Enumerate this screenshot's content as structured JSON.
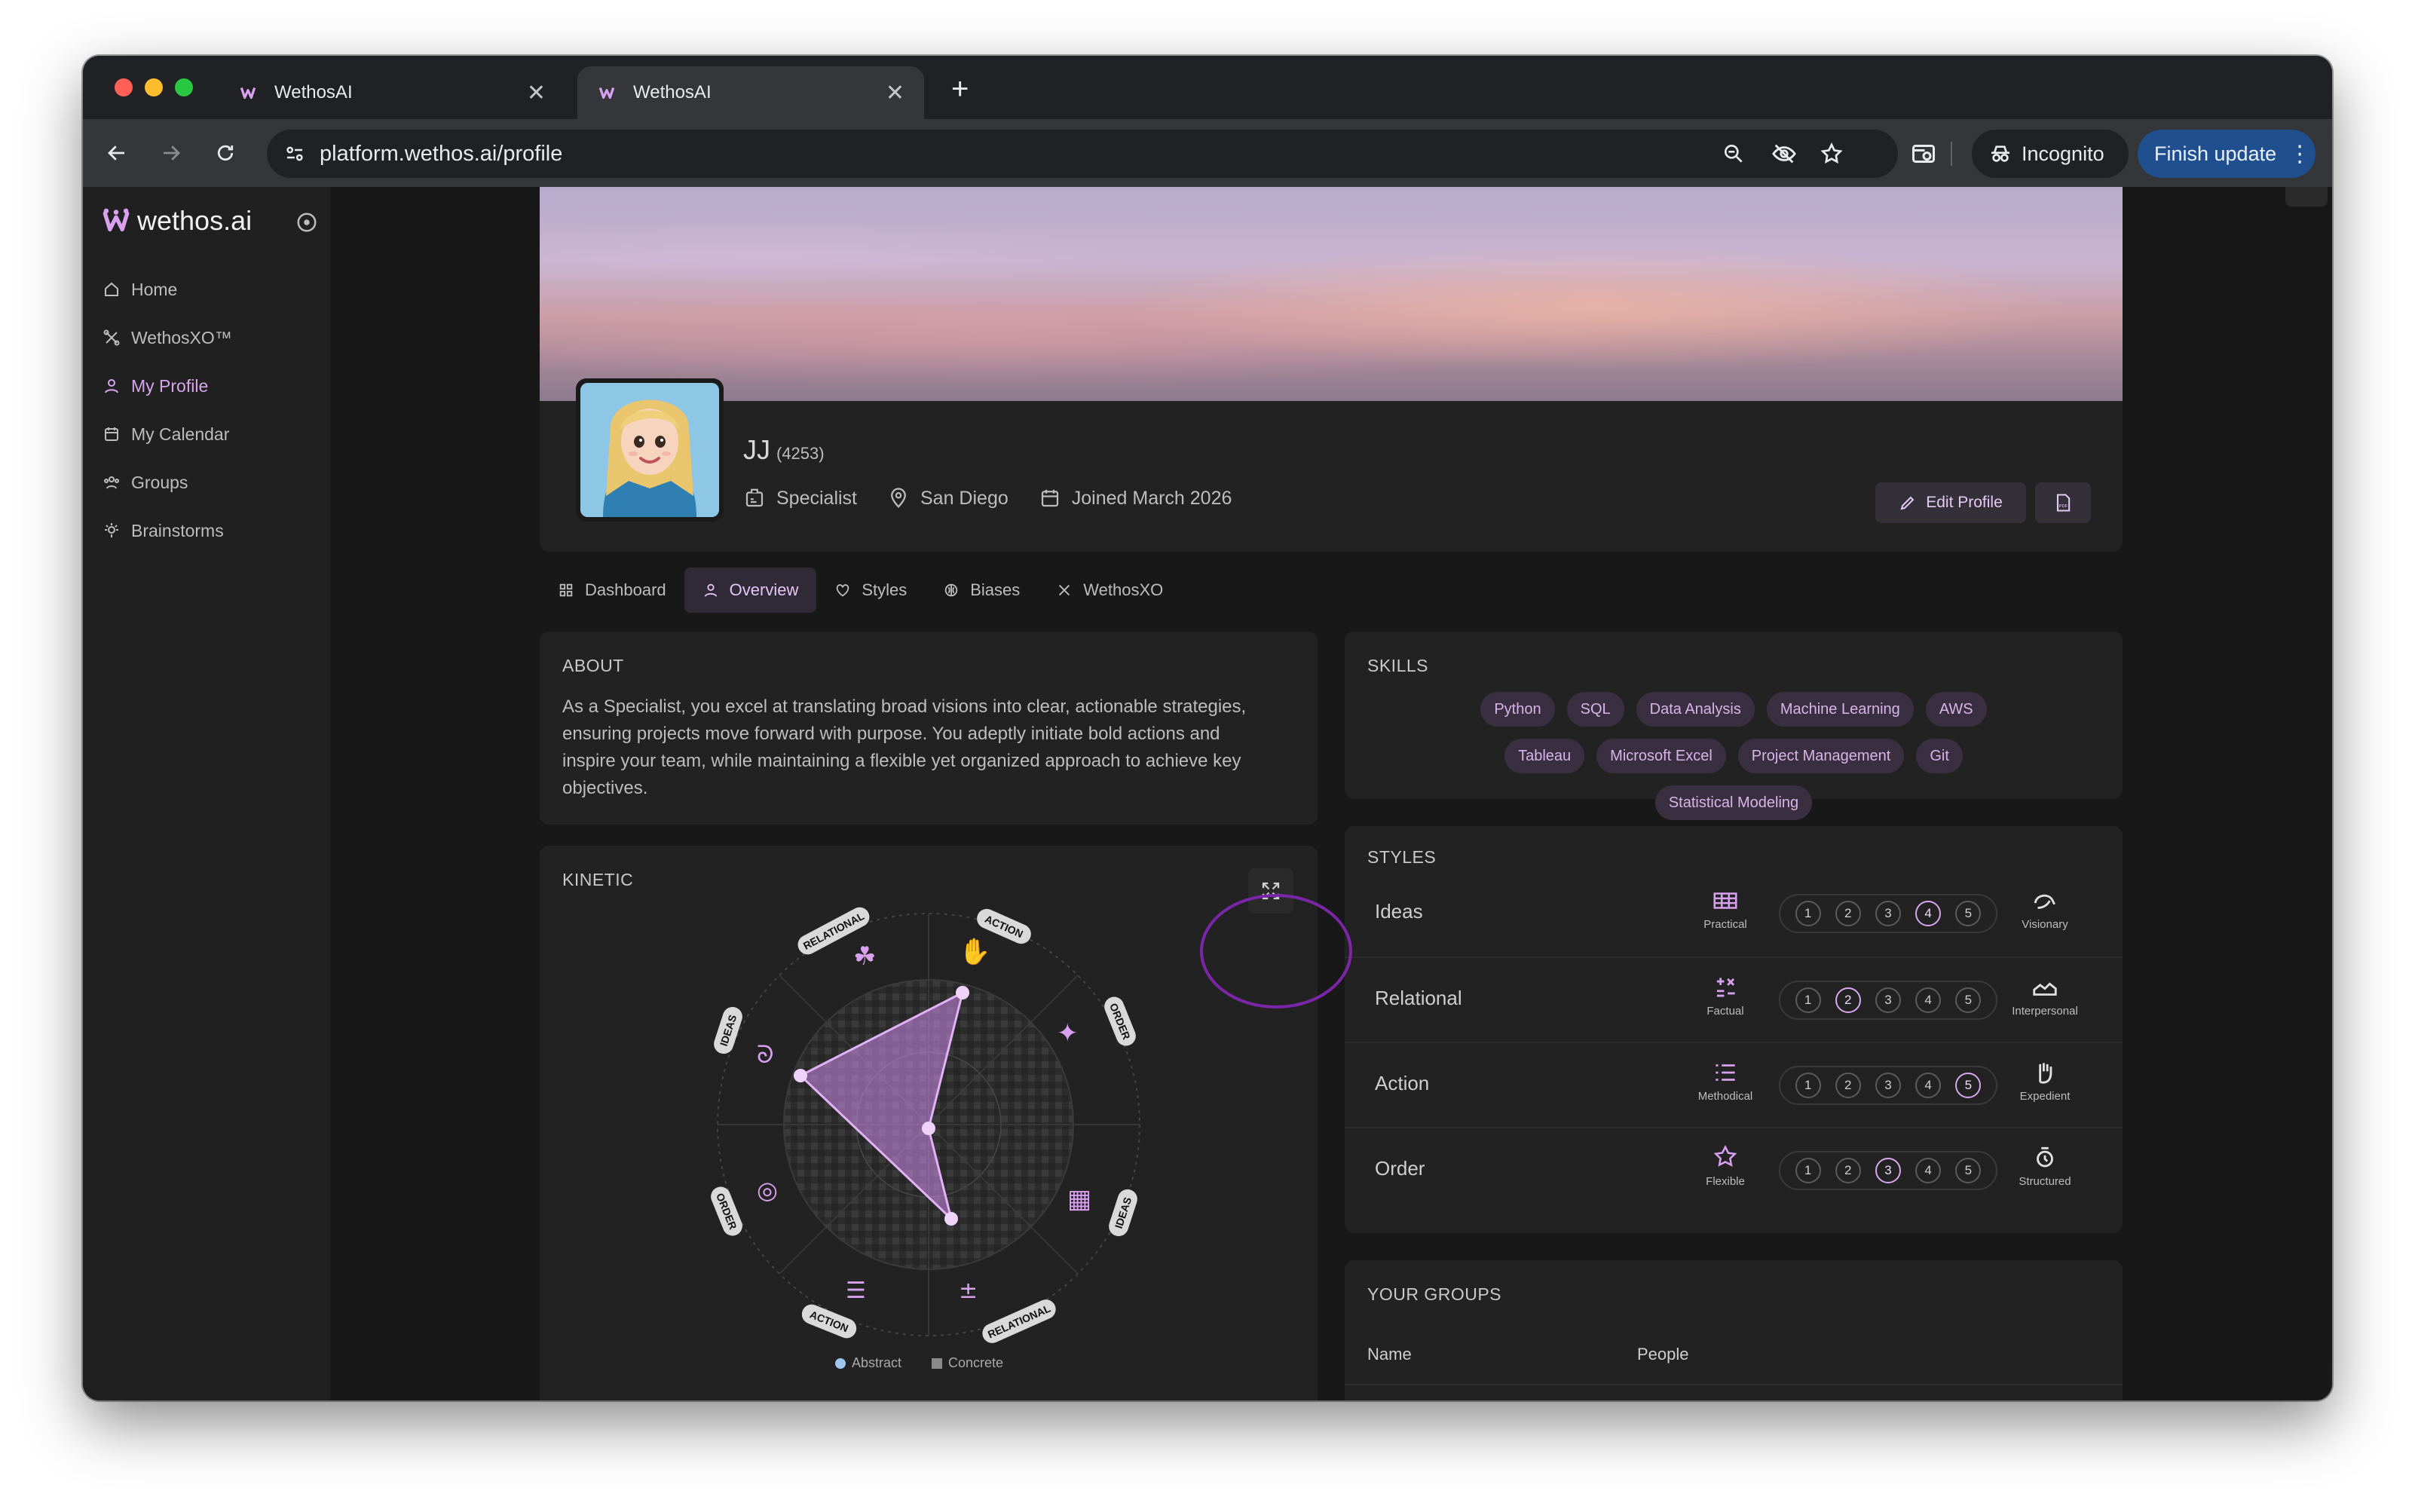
{
  "browser": {
    "tabs": [
      {
        "title": "WethosAI",
        "close": "✕"
      },
      {
        "title": "WethosAI",
        "close": "✕"
      }
    ],
    "new_tab": "+",
    "url": "platform.wethos.ai/profile",
    "incognito_label": "Incognito",
    "finish_update_label": "Finish update"
  },
  "sidebar": {
    "brand": "wethos.ai",
    "items": [
      {
        "label": "Home",
        "icon": "home-icon"
      },
      {
        "label": "WethosXO™",
        "icon": "xo-icon"
      },
      {
        "label": "My Profile",
        "icon": "user-icon"
      },
      {
        "label": "My Calendar",
        "icon": "calendar-icon"
      },
      {
        "label": "Groups",
        "icon": "groups-icon"
      },
      {
        "label": "Brainstorms",
        "icon": "bulb-icon"
      }
    ],
    "active_item": "My Profile"
  },
  "profile": {
    "name": "JJ",
    "id_label": "(4253)",
    "role": "Specialist",
    "location": "San Diego",
    "joined": "Joined March 2026",
    "edit_label": "Edit Profile",
    "pdf_label": "PDF"
  },
  "profile_tabs": [
    {
      "label": "Dashboard"
    },
    {
      "label": "Overview"
    },
    {
      "label": "Styles"
    },
    {
      "label": "Biases"
    },
    {
      "label": "WethosXO"
    }
  ],
  "active_tab": "Overview",
  "about": {
    "title": "ABOUT",
    "text": "As a Specialist, you excel at translating broad visions into clear, actionable strategies, ensuring projects move forward with purpose. You adeptly initiate bold actions and inspire your team, while maintaining a flexible yet organized approach to achieve key objectives."
  },
  "skills": {
    "title": "SKILLS",
    "items": [
      "Python",
      "SQL",
      "Data Analysis",
      "Machine Learning",
      "AWS",
      "Tableau",
      "Microsoft Excel",
      "Project Management",
      "Git",
      "Statistical Modeling"
    ]
  },
  "kinetic": {
    "title": "KINETIC",
    "labels": [
      "RELATIONAL",
      "ACTION",
      "ORDER",
      "IDEAS",
      "RELATIONAL",
      "ACTION",
      "ORDER",
      "IDEAS"
    ],
    "legend": [
      "Abstract",
      "Concrete"
    ],
    "accent": "#d9a0f0"
  },
  "styles": {
    "title": "STYLES",
    "rows": [
      {
        "name": "Ideas",
        "left": "Practical",
        "right": "Visionary",
        "value": 4
      },
      {
        "name": "Relational",
        "left": "Factual",
        "right": "Interpersonal",
        "value": 2
      },
      {
        "name": "Action",
        "left": "Methodical",
        "right": "Expedient",
        "value": 5
      },
      {
        "name": "Order",
        "left": "Flexible",
        "right": "Structured",
        "value": 3
      }
    ],
    "scale": [
      "1",
      "2",
      "3",
      "4",
      "5"
    ]
  },
  "groups": {
    "title": "YOUR GROUPS",
    "columns": [
      "Name",
      "People"
    ]
  }
}
